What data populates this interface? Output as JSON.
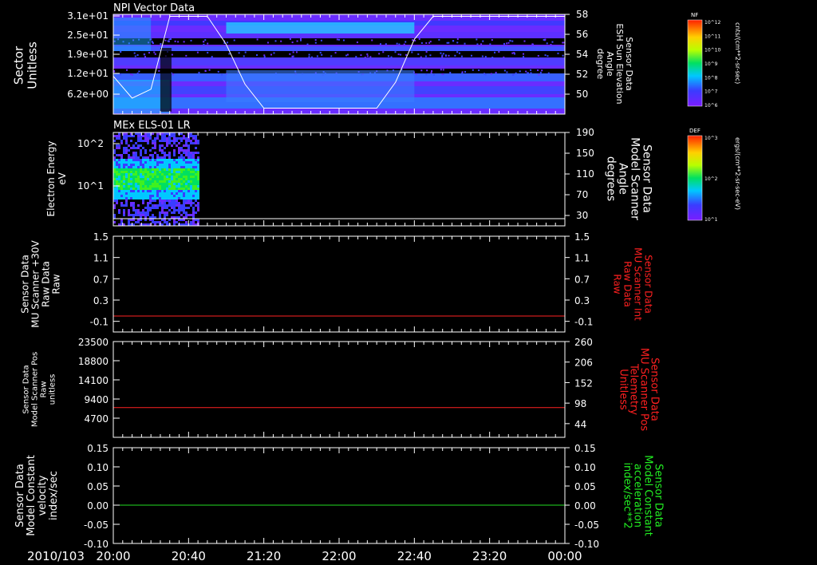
{
  "date_label": "2010/103",
  "x_axis": {
    "range": [
      "20:00",
      "24:00"
    ],
    "tick_labels": [
      "20:00",
      "20:40",
      "21:20",
      "22:00",
      "22:40",
      "23:20",
      "00:00"
    ]
  },
  "colors": {
    "axis": "#ffffff",
    "red_line": "#ff2222",
    "green_line": "#22dd22",
    "right_label_red": "#ff2020",
    "right_label_green": "#22ee22"
  },
  "colorbars": [
    {
      "label": "NF",
      "units": "cnts/(cm**2-sr-sec)",
      "tick_labels": [
        "10^12",
        "10^11",
        "10^10",
        "10^9",
        "10^8",
        "10^7",
        "10^6"
      ]
    },
    {
      "label": "DEF",
      "units": "ergs/(cm**2-sr-sec-eV)",
      "tick_labels": [
        "10^3",
        "10^2",
        "10^1"
      ]
    }
  ],
  "chart_data": [
    {
      "type": "heatmap",
      "title": "NPI Vector Data",
      "ylabel": [
        "Sector",
        "Unitless"
      ],
      "y_tick_labels": [
        "3.1e+01",
        "2.5e+01",
        "1.9e+01",
        "1.2e+01",
        "6.2e+00"
      ],
      "right_ylabel": [
        "Sensor Data",
        "ESH Sun Elevation",
        "Angle",
        "degree"
      ],
      "right_ylim": [
        48,
        58
      ],
      "right_tick_labels": [
        "58",
        "56",
        "54",
        "52",
        "50"
      ],
      "overlay_line": {
        "name": "ESH Sun Elevation Angle",
        "x": [
          "20:00",
          "20:10",
          "20:20",
          "20:30",
          "20:40",
          "20:50",
          "21:00",
          "21:10",
          "21:20",
          "21:40",
          "22:00",
          "22:20",
          "22:30",
          "22:40",
          "22:50",
          "23:00",
          "23:20",
          "24:00"
        ],
        "y": [
          51.8,
          49.6,
          50.5,
          57.8,
          57.8,
          57.8,
          55.0,
          51.0,
          48.6,
          48.6,
          48.6,
          48.6,
          51.2,
          55.5,
          57.8,
          57.8,
          57.8,
          57.8
        ]
      }
    },
    {
      "type": "heatmap",
      "title": "MEx ELS-01 LR",
      "ylabel": [
        "Electron Energy",
        "eV"
      ],
      "y_tick_labels": [
        "10^2",
        "10^1"
      ],
      "data_extent": [
        "20:00",
        "20:45"
      ],
      "right_ylabel": [
        "Sensor Data",
        "Model Scanner",
        "Angle",
        "degrees"
      ],
      "right_ylim": [
        10,
        190
      ],
      "right_tick_labels": [
        "190",
        "150",
        "110",
        "70",
        "30"
      ]
    },
    {
      "type": "line",
      "ylabel": [
        "Sensor Data",
        "MU Scanner +30V",
        "Raw Data",
        "Raw"
      ],
      "ylim": [
        -0.3,
        1.5
      ],
      "y_tick_labels": [
        "1.5",
        "1.1",
        "0.7",
        "0.3",
        "-0.1"
      ],
      "right_ylabel": [
        "Sensor Data",
        "MU Scanner Int",
        "Raw Data",
        "Raw"
      ],
      "right_tick_labels": [
        "1.5",
        "1.1",
        "0.7",
        "0.3",
        "-0.1"
      ],
      "series": [
        {
          "x": [
            "20:00",
            "24:00"
          ],
          "values": [
            0.0,
            0.0
          ]
        }
      ]
    },
    {
      "type": "line",
      "ylabel": [
        "Sensor Data",
        "Model Scanner Pos",
        "Raw",
        "unitless"
      ],
      "ylim": [
        0,
        23500
      ],
      "y_tick_labels": [
        "23500",
        "18800",
        "14100",
        "9400",
        "4700"
      ],
      "right_ylabel": [
        "Sensor Data",
        "MU Scanner Pos",
        "Telemetry",
        "Unitless"
      ],
      "right_ylim": [
        8,
        260
      ],
      "right_tick_labels": [
        "260",
        "206",
        "152",
        "98",
        "44"
      ],
      "series": [
        {
          "x": [
            "20:00",
            "24:00"
          ],
          "values": [
            7300,
            7300
          ]
        }
      ]
    },
    {
      "type": "line",
      "ylabel": [
        "Sensor Data",
        "Model Constant",
        "velocity",
        "index/sec"
      ],
      "ylim": [
        -0.1,
        0.15
      ],
      "y_tick_labels": [
        "0.15",
        "0.10",
        "0.05",
        "0.00",
        "-0.05",
        "-0.10"
      ],
      "right_ylabel": [
        "Sensor Data",
        "Model Constant",
        "acceleration",
        "index/sec**2"
      ],
      "right_tick_labels": [
        "0.15",
        "0.10",
        "0.05",
        "0.00",
        "-0.05",
        "-0.10"
      ],
      "series": [
        {
          "x": [
            "20:00",
            "24:00"
          ],
          "values": [
            0.0,
            0.0
          ]
        }
      ]
    }
  ]
}
